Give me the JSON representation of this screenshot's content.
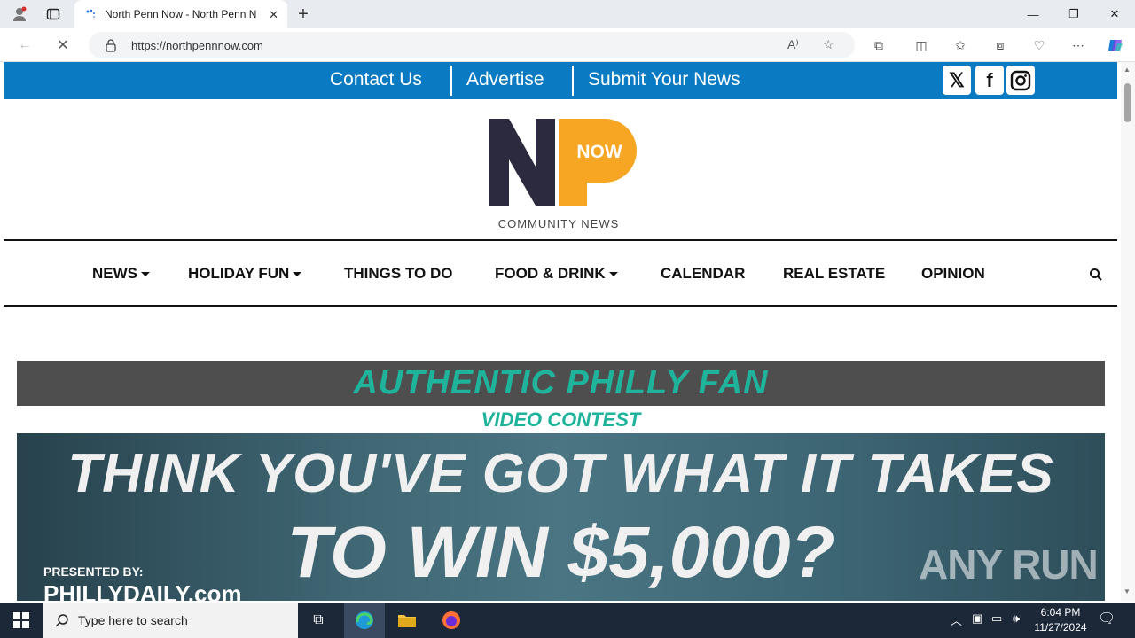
{
  "browser": {
    "tab_title": "North Penn Now - North Penn N",
    "url": "https://northpennnow.com"
  },
  "site": {
    "top_links": [
      "Contact Us",
      "Advertise",
      "Submit Your News"
    ],
    "logo_text": "NOW",
    "logo_tagline": "COMMUNITY NEWS",
    "menu": [
      "NEWS",
      "HOLIDAY FUN",
      "THINGS TO DO",
      "FOOD & DRINK",
      "CALENDAR",
      "REAL ESTATE",
      "OPINION"
    ]
  },
  "banner": {
    "title": "AUTHENTIC PHILLY FAN",
    "subtitle": "VIDEO CONTEST",
    "headline1": "THINK YOU'VE GOT WHAT IT TAKES",
    "headline2": "TO WIN $5,000?",
    "presented": "PRESENTED BY:",
    "sponsor": "PHILLYDAILY.com"
  },
  "watermark": "ANY RUN",
  "taskbar": {
    "search_placeholder": "Type here to search",
    "time": "6:04 PM",
    "date": "11/27/2024"
  },
  "colors": {
    "brand_blue": "#0a7ac2",
    "accent_teal": "#1fb39b",
    "logo_orange": "#f6a623",
    "logo_navy": "#2b2a3e"
  }
}
